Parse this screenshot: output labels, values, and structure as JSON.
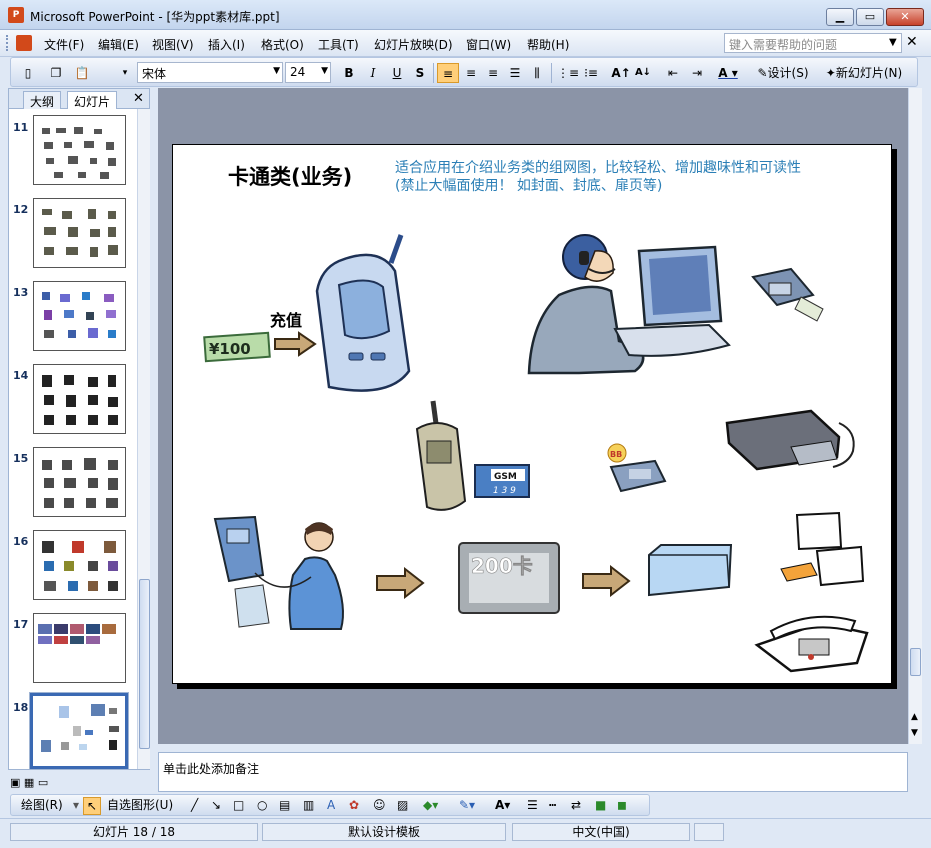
{
  "window": {
    "title": "Microsoft PowerPoint - [华为ppt素材库.ppt]",
    "app_icon_text": "P"
  },
  "menu": {
    "items": [
      "文件(F)",
      "编辑(E)",
      "视图(V)",
      "插入(I)",
      "格式(O)",
      "工具(T)",
      "幻灯片放映(D)",
      "窗口(W)",
      "帮助(H)"
    ],
    "help_placeholder": "键入需要帮助的问题"
  },
  "toolbar": {
    "font": "宋体",
    "size": "24",
    "bold": "B",
    "italic": "I",
    "underline": "U",
    "shadow": "S",
    "design_label": "设计(S)",
    "new_slide_label": "新幻灯片(N)"
  },
  "left_pane": {
    "tabs": [
      "大纲",
      "幻灯片"
    ],
    "slides": [
      {
        "num": "11"
      },
      {
        "num": "12"
      },
      {
        "num": "13"
      },
      {
        "num": "14"
      },
      {
        "num": "15"
      },
      {
        "num": "16"
      },
      {
        "num": "17"
      },
      {
        "num": "18",
        "selected": true
      }
    ]
  },
  "slide": {
    "title": "卡通类(业务)",
    "subtitle_line1": "适合应用在介绍业务类的组网图，比较轻松、增加趣味性和可读性",
    "subtitle_line2": "(禁止大幅面使用！ 如封面、封底、扉页等)",
    "recharge_label": "充值",
    "money_label": "¥100",
    "gsm_label": "GSM",
    "gsm_num": "1 3 9",
    "card_label": "200卡",
    "pager_label": "BB"
  },
  "notes": {
    "placeholder": "单击此处添加备注"
  },
  "drawbar": {
    "draw_label": "绘图(R)",
    "autoshape_label": "自选图形(U)"
  },
  "status": {
    "slide_info": "幻灯片 18 / 18",
    "template": "默认设计模板",
    "language": "中文(中国)"
  },
  "colors": {
    "accent": "#2b7fb6",
    "selected_tab": "#ffcf7a",
    "canvas_bg": "#8b94a7"
  }
}
